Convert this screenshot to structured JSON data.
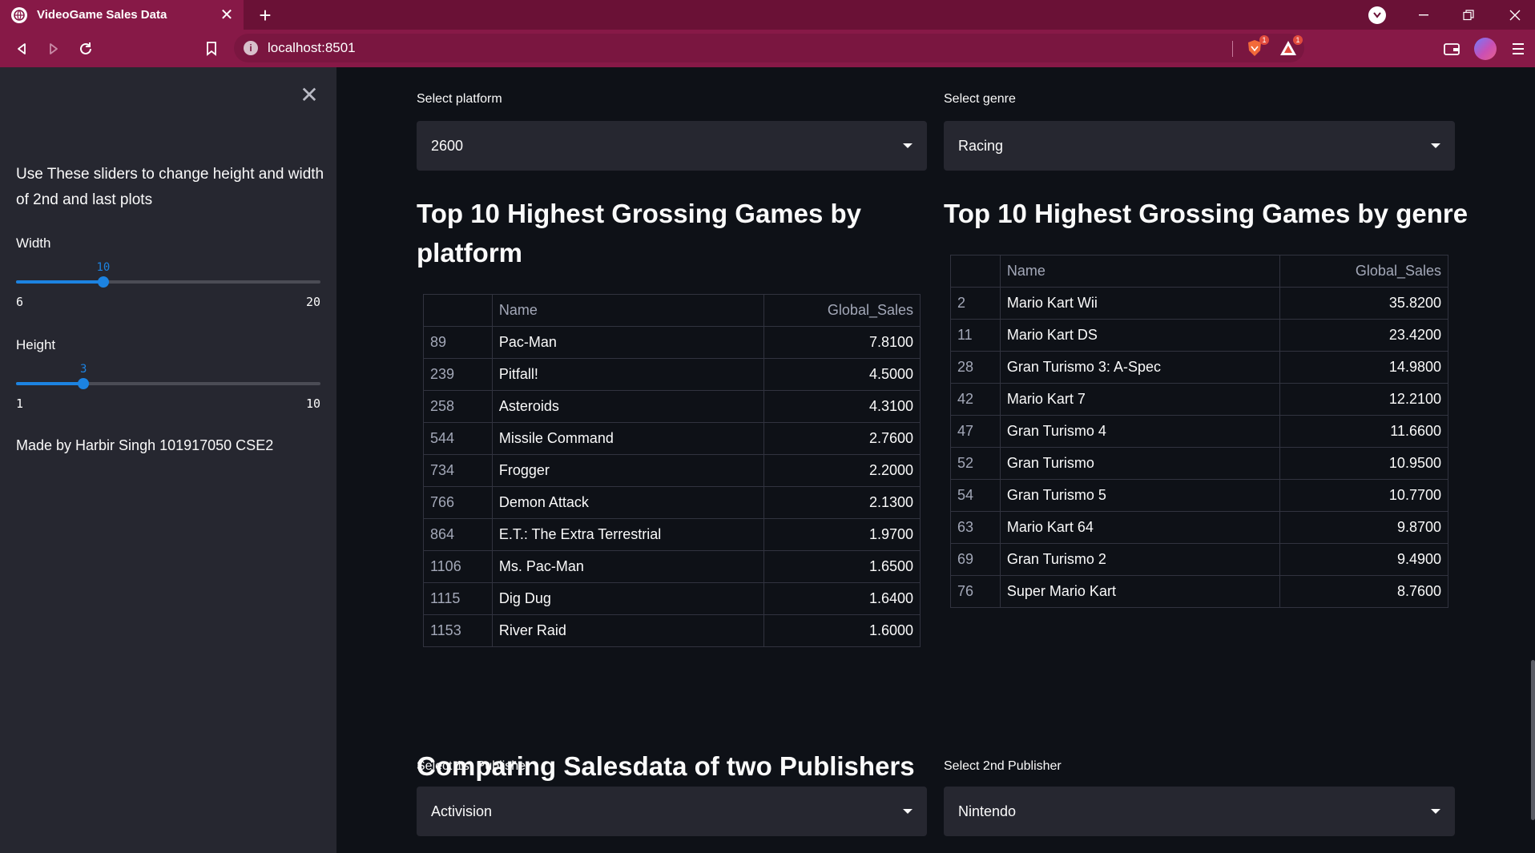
{
  "browser": {
    "tab_title": "VideoGame Sales Data",
    "url": "localhost:8501",
    "brave_badge": "1",
    "rewards_badge": "1"
  },
  "sidebar": {
    "intro": "Use These sliders to change height and width of 2nd and last plots",
    "width_slider": {
      "label": "Width",
      "value": "10",
      "min": "6",
      "max": "20",
      "fraction": 0.2857
    },
    "height_slider": {
      "label": "Height",
      "value": "3",
      "min": "1",
      "max": "10",
      "fraction": 0.2222
    },
    "credit": "Made by Harbir Singh 101917050 CSE2"
  },
  "filters": {
    "platform_label": "Select platform",
    "platform_value": "2600",
    "genre_label": "Select genre",
    "genre_value": "Racing"
  },
  "platform_table": {
    "title": "Top 10 Highest Grossing Games by platform",
    "columns": [
      "",
      "Name",
      "Global_Sales"
    ],
    "rows": [
      {
        "index": "89",
        "name": "Pac-Man",
        "sales": "7.8100"
      },
      {
        "index": "239",
        "name": "Pitfall!",
        "sales": "4.5000"
      },
      {
        "index": "258",
        "name": "Asteroids",
        "sales": "4.3100"
      },
      {
        "index": "544",
        "name": "Missile Command",
        "sales": "2.7600"
      },
      {
        "index": "734",
        "name": "Frogger",
        "sales": "2.2000"
      },
      {
        "index": "766",
        "name": "Demon Attack",
        "sales": "2.1300"
      },
      {
        "index": "864",
        "name": "E.T.: The Extra Terrestrial",
        "sales": "1.9700"
      },
      {
        "index": "1106",
        "name": "Ms. Pac-Man",
        "sales": "1.6500"
      },
      {
        "index": "1115",
        "name": "Dig Dug",
        "sales": "1.6400"
      },
      {
        "index": "1153",
        "name": "River Raid",
        "sales": "1.6000"
      }
    ]
  },
  "genre_table": {
    "title": "Top 10 Highest Grossing Games by genre",
    "columns": [
      "",
      "Name",
      "Global_Sales"
    ],
    "rows": [
      {
        "index": "2",
        "name": "Mario Kart Wii",
        "sales": "35.8200"
      },
      {
        "index": "11",
        "name": "Mario Kart DS",
        "sales": "23.4200"
      },
      {
        "index": "28",
        "name": "Gran Turismo 3: A-Spec",
        "sales": "14.9800"
      },
      {
        "index": "42",
        "name": "Mario Kart 7",
        "sales": "12.2100"
      },
      {
        "index": "47",
        "name": "Gran Turismo 4",
        "sales": "11.6600"
      },
      {
        "index": "52",
        "name": "Gran Turismo",
        "sales": "10.9500"
      },
      {
        "index": "54",
        "name": "Gran Turismo 5",
        "sales": "10.7700"
      },
      {
        "index": "63",
        "name": "Mario Kart 64",
        "sales": "9.8700"
      },
      {
        "index": "69",
        "name": "Gran Turismo 2",
        "sales": "9.4900"
      },
      {
        "index": "76",
        "name": "Super Mario Kart",
        "sales": "8.7600"
      }
    ]
  },
  "publishers": {
    "title": "Comparing Salesdata of two Publishers",
    "first_label": "Select 1st Publisher",
    "first_value": "Activision",
    "second_label": "Select 2nd Publisher",
    "second_value": "Nintendo"
  },
  "colors": {
    "browser_frame": "#6a1136",
    "browser_toolbar": "#871947",
    "app_background": "#0e1117",
    "sidebar_background": "#262730",
    "slider_accent": "#1c83e1"
  }
}
